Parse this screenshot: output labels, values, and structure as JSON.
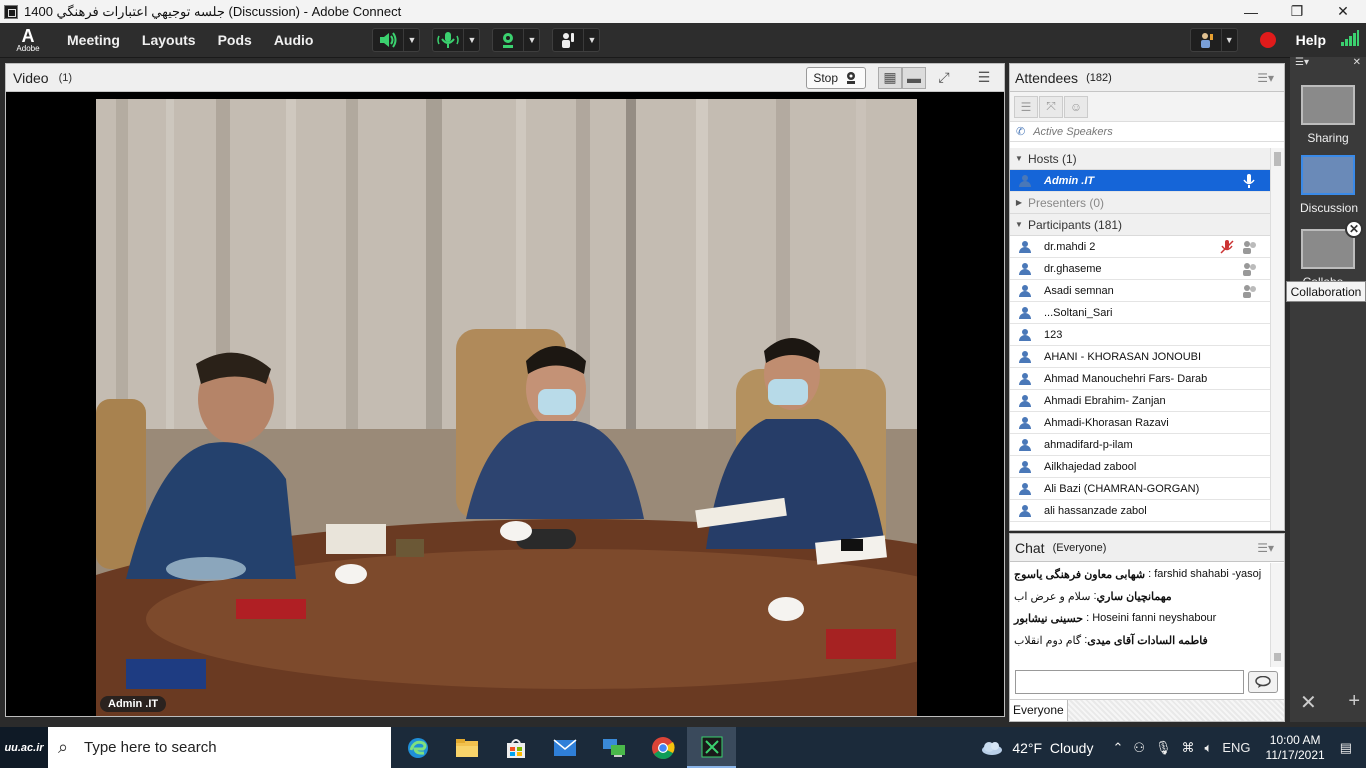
{
  "window": {
    "title": "جلسه توجيهي اعتبارات فرهنگي 1400 (Discussion) - Adobe Connect",
    "minimize": "—",
    "restore": "❐",
    "close": "✕"
  },
  "menubar": {
    "logo_text": "Adobe",
    "items": [
      "Meeting",
      "Layouts",
      "Pods",
      "Audio"
    ],
    "help": "Help",
    "colors": {
      "speaker_active": "#3bd16f",
      "record": "#e01b1b",
      "signal": "#3bd16f"
    }
  },
  "video": {
    "title": "Video",
    "count": "(1)",
    "stop_label": "Stop",
    "speaker_label": "Admin .IT"
  },
  "attendees": {
    "title": "Attendees",
    "count": "(182)",
    "active_speakers": "Active Speakers",
    "hosts_label": "Hosts (1)",
    "host_name": "Admin .IT",
    "presenters_label": "Presenters (0)",
    "participants_label": "Participants (181)",
    "participants": [
      "dr.mahdi 2",
      "dr.ghaseme",
      "Asadi semnan",
      "...Soltani_Sari",
      "123",
      "AHANI - KHORASAN JONOUBI",
      "Ahmad Manouchehri  Fars- Darab",
      "Ahmadi Ebrahim- Zanjan",
      "Ahmadi-Khorasan Razavi",
      "ahmadifard-p-ilam",
      "Ailkhajedad    zabool",
      "Ali Bazi (CHAMRAN-GORGAN)",
      "ali hassanzade  zabol"
    ]
  },
  "chat": {
    "title": "Chat",
    "scope": "(Everyone)",
    "messages": [
      {
        "sender": "farshid shahabi -yasoj",
        "text": "شهابی معاون فرهنگی یاسوج"
      },
      {
        "sender": "مهمانچيان ساري",
        "text": "سلام و عرض اب"
      },
      {
        "sender": "Hoseini fanni neyshabour",
        "text": "حسینی نیشابور"
      },
      {
        "sender": "فاطمه السادات آقای میدی",
        "text": "گام دوم انقلاب"
      }
    ],
    "tab": "Everyone"
  },
  "layouts": {
    "items": [
      "Sharing",
      "Discussion",
      "Collabo..."
    ],
    "tooltip": "Collaboration"
  },
  "taskbar": {
    "start_text": "uu.ac.ir",
    "search_placeholder": "Type here to search",
    "weather_temp": "42°F",
    "weather_text": "Cloudy",
    "language": "ENG",
    "time": "10:00 AM",
    "date": "11/17/2021"
  }
}
